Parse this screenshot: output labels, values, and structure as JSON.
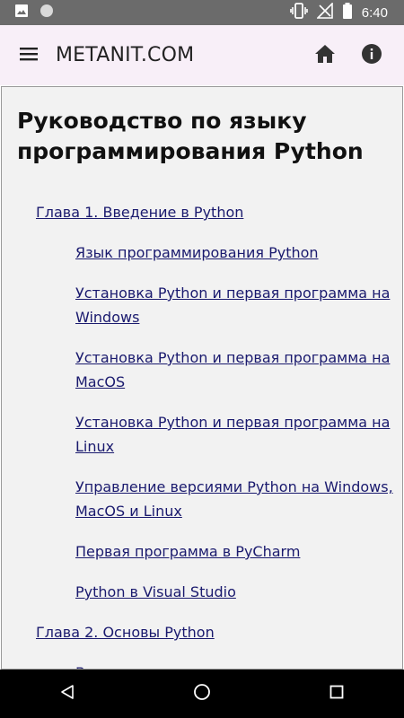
{
  "status_bar": {
    "time": "6:40",
    "icons": [
      "image-icon",
      "circle-icon",
      "vibrate-icon",
      "no-signal-icon",
      "battery-icon"
    ]
  },
  "app_bar": {
    "title": "METANIT.COM",
    "icons": [
      "menu-icon",
      "home-icon",
      "info-icon"
    ]
  },
  "page": {
    "title": "Руководство по языку программирования Python",
    "toc": [
      {
        "type": "chapter",
        "label": "Глава 1. Введение в Python"
      },
      {
        "type": "lesson",
        "label": "Язык программирования Python"
      },
      {
        "type": "lesson",
        "label": "Установка Python и первая программа на Windows"
      },
      {
        "type": "lesson",
        "label": "Установка Python и первая программа на MacOS"
      },
      {
        "type": "lesson",
        "label": "Установка Python и первая программа на Linux"
      },
      {
        "type": "lesson",
        "label": "Управление версиями Python на Windows, MacOS и Linux"
      },
      {
        "type": "lesson",
        "label": "Первая программа в PyCharm"
      },
      {
        "type": "lesson",
        "label": "Python в Visual Studio"
      },
      {
        "type": "chapter",
        "label": "Глава 2. Основы Python"
      },
      {
        "type": "lesson",
        "label": "Введение в написание программ"
      }
    ]
  },
  "nav_bar": {
    "icons": [
      "back-icon",
      "home-circle-icon",
      "recents-icon"
    ]
  },
  "colors": {
    "status_bar": "#6b6b6b",
    "app_bar": "#f8eff8",
    "content_bg": "#f2f2f2",
    "link": "#1a1a6e",
    "nav_bar": "#000000"
  }
}
